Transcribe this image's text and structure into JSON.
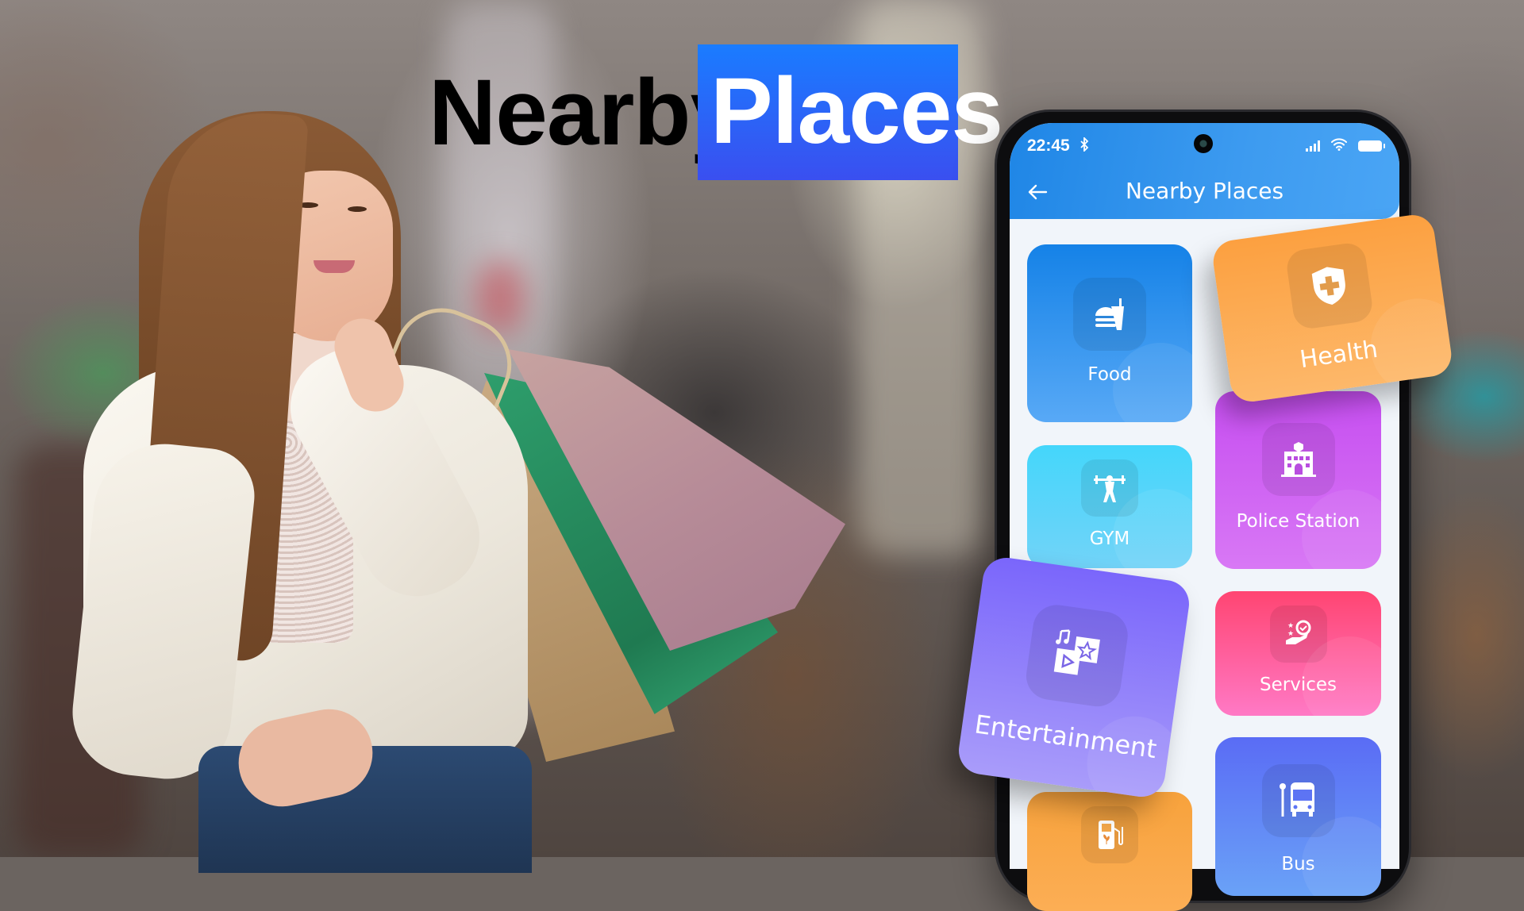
{
  "headline": {
    "word1": "Nearby",
    "word2": "Places",
    "accent_color": "#1a7cff"
  },
  "phone": {
    "status_bar": {
      "time": "22:45",
      "icons": [
        "bluetooth-icon",
        "signal-icon",
        "wifi-icon",
        "battery-icon"
      ]
    },
    "app_bar": {
      "title": "Nearby Places",
      "back_icon": "arrow-left-icon"
    },
    "categories": [
      {
        "label": "Food",
        "icon": "burger-drink-icon",
        "color": "#1582e7"
      },
      {
        "label": "Health",
        "icon": "shield-cross-icon",
        "color": "#fca040"
      },
      {
        "label": "GYM",
        "icon": "weightlifter-icon",
        "color": "#44d6fb"
      },
      {
        "label": "Police Station",
        "icon": "police-building-icon",
        "color": "#c64ef0"
      },
      {
        "label": "Entertainment",
        "icon": "media-music-star-icon",
        "color": "#7a66fb"
      },
      {
        "label": "Services",
        "icon": "hand-gear-icon",
        "color": "#ff4572"
      },
      {
        "label": "",
        "icon": "fuel-station-icon",
        "color": "#f7a23c"
      },
      {
        "label": "Bus",
        "icon": "bus-stop-icon",
        "color": "#5a6cf5"
      }
    ]
  }
}
